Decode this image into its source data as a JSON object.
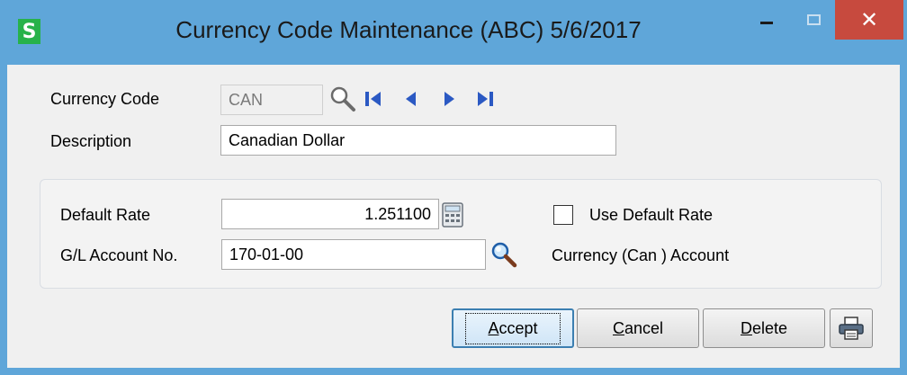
{
  "window": {
    "app_icon_letter": "S",
    "title": "Currency Code Maintenance (ABC) 5/6/2017",
    "close_glyph": "✕"
  },
  "form": {
    "currency_code_label": "Currency Code",
    "currency_code_value": "CAN",
    "description_label": "Description",
    "description_value": "Canadian Dollar",
    "default_rate_label": "Default Rate",
    "default_rate_value": "1.251100",
    "use_default_rate_label": "Use Default Rate",
    "use_default_rate_checked": false,
    "gl_account_label": "G/L Account No.",
    "gl_account_value": "170-01-00",
    "gl_account_description": "Currency (Can ) Account"
  },
  "buttons": {
    "accept_mnemonic": "A",
    "accept_rest": "ccept",
    "cancel_mnemonic": "C",
    "cancel_rest": "ancel",
    "delete_mnemonic": "D",
    "delete_rest": "elete"
  },
  "icons": {
    "lookup": "magnifier-icon",
    "nav_first": "nav-first-icon",
    "nav_prev": "nav-prev-icon",
    "nav_next": "nav-next-icon",
    "nav_last": "nav-last-icon",
    "calculator": "calculator-icon",
    "printer": "printer-icon"
  },
  "colors": {
    "titlebar": "#5fa6d9",
    "close_button": "#c74a3e",
    "nav_arrows": "#2b59c3",
    "app_icon": "#27b24a"
  }
}
